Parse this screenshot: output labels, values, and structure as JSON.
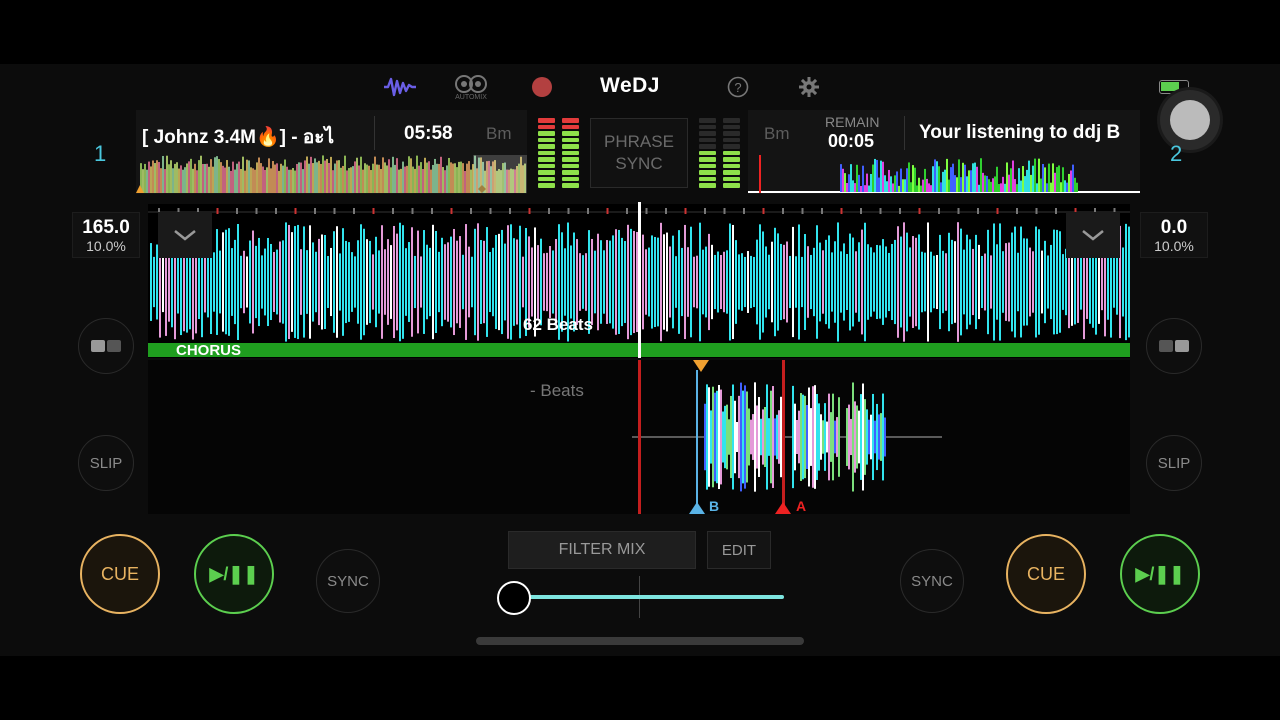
{
  "app": {
    "name": "WeDJ"
  },
  "topbar": {
    "automix_label": "AUTOMIX",
    "help_icon": "question-circle-icon",
    "settings_icon": "gear-icon"
  },
  "deck1": {
    "number": "1",
    "title": "[ Johnz 3.4M🔥] - อะไ",
    "time": "05:58",
    "key": "Bm",
    "bpm": "165.0",
    "pitch": "10.0%",
    "cue_label": "CUE",
    "play_label": "▶/❚❚",
    "sync_label": "SYNC",
    "slip_label": "SLIP"
  },
  "deck2": {
    "number": "2",
    "title": "Your listening to ddj B",
    "remain_label": "REMAIN",
    "time": "00:05",
    "key": "Bm",
    "bpm": "0.0",
    "pitch": "10.0%",
    "cue_label": "CUE",
    "play_label": "▶/❚❚",
    "sync_label": "SYNC",
    "slip_label": "SLIP"
  },
  "center": {
    "phrase_sync_line1": "PHRASE",
    "phrase_sync_line2": "SYNC",
    "filter_mix_label": "FILTER MIX",
    "edit_label": "EDIT",
    "crossfader_value": 0.05
  },
  "waveform": {
    "beats_label": "62 Beats",
    "section_label": "CHORUS",
    "lower_beats_label": "- Beats",
    "loop_b": "B",
    "loop_a": "A"
  },
  "colors": {
    "wave_cyan": "#31e4ee",
    "wave_pink": "#e49ad8",
    "chorus_green": "#1f9e1f",
    "cue_orange": "#e8b361",
    "play_green": "#5ccf4f",
    "deck_blue": "#4ac7de"
  }
}
